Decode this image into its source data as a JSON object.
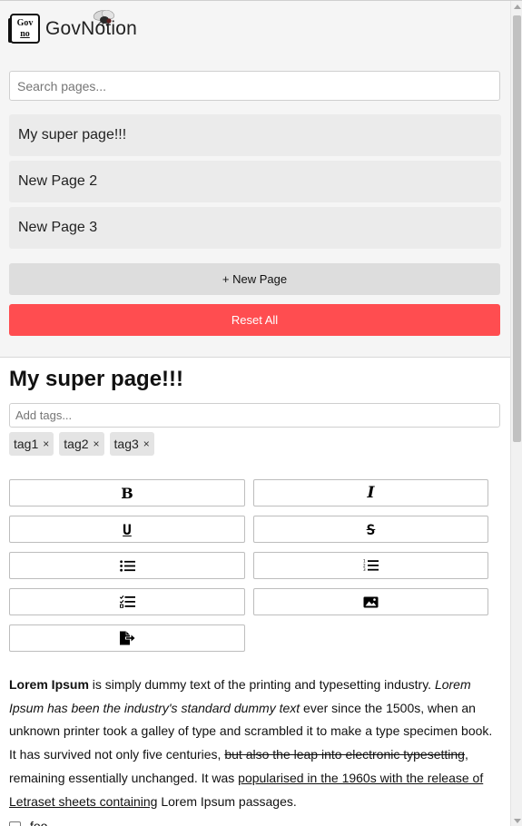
{
  "app": {
    "logo_top": "Gov",
    "logo_bottom": "no",
    "name": "GovNotion"
  },
  "sidebar": {
    "search_placeholder": "Search pages...",
    "pages": [
      "My super page!!!",
      "New Page 2",
      "New Page 3"
    ],
    "new_page_label": "+ New Page",
    "reset_label": "Reset All",
    "reset_color": "#ff4d50"
  },
  "editor": {
    "title": "My super page!!!",
    "tags_placeholder": "Add tags...",
    "tags": [
      "tag1",
      "tag2",
      "tag3"
    ],
    "tag_remove_glyph": "×",
    "toolbar": {
      "bold_label": "B",
      "italic_label": "I",
      "underline_label": "U",
      "strike_label": "S",
      "icons": [
        "bold-icon",
        "italic-icon",
        "underline-icon",
        "strikethrough-icon",
        "bullet-list-icon",
        "numbered-list-icon",
        "checklist-icon",
        "image-icon",
        "export-icon"
      ]
    },
    "body": {
      "p1_bold": "Lorem Ipsum",
      "p1_text1": " is simply dummy text of the printing and typesetting industry. ",
      "p1_italic": "Lorem Ipsum has been the industry's standard dummy text",
      "p1_text2": " ever since the 1500s, when an unknown printer took a galley of type and scrambled it to make a type specimen book. It has survived not only five centuries, ",
      "p1_strike": "but also the leap into electronic typesetting",
      "p1_text3": ", remaining essentially unchanged. It was ",
      "p1_underline": "popularised in the 1960s with the release of Letraset sheets containing",
      "p1_text4": " Lorem Ipsum passages."
    },
    "todo": {
      "text": "foo",
      "checked": false
    }
  }
}
